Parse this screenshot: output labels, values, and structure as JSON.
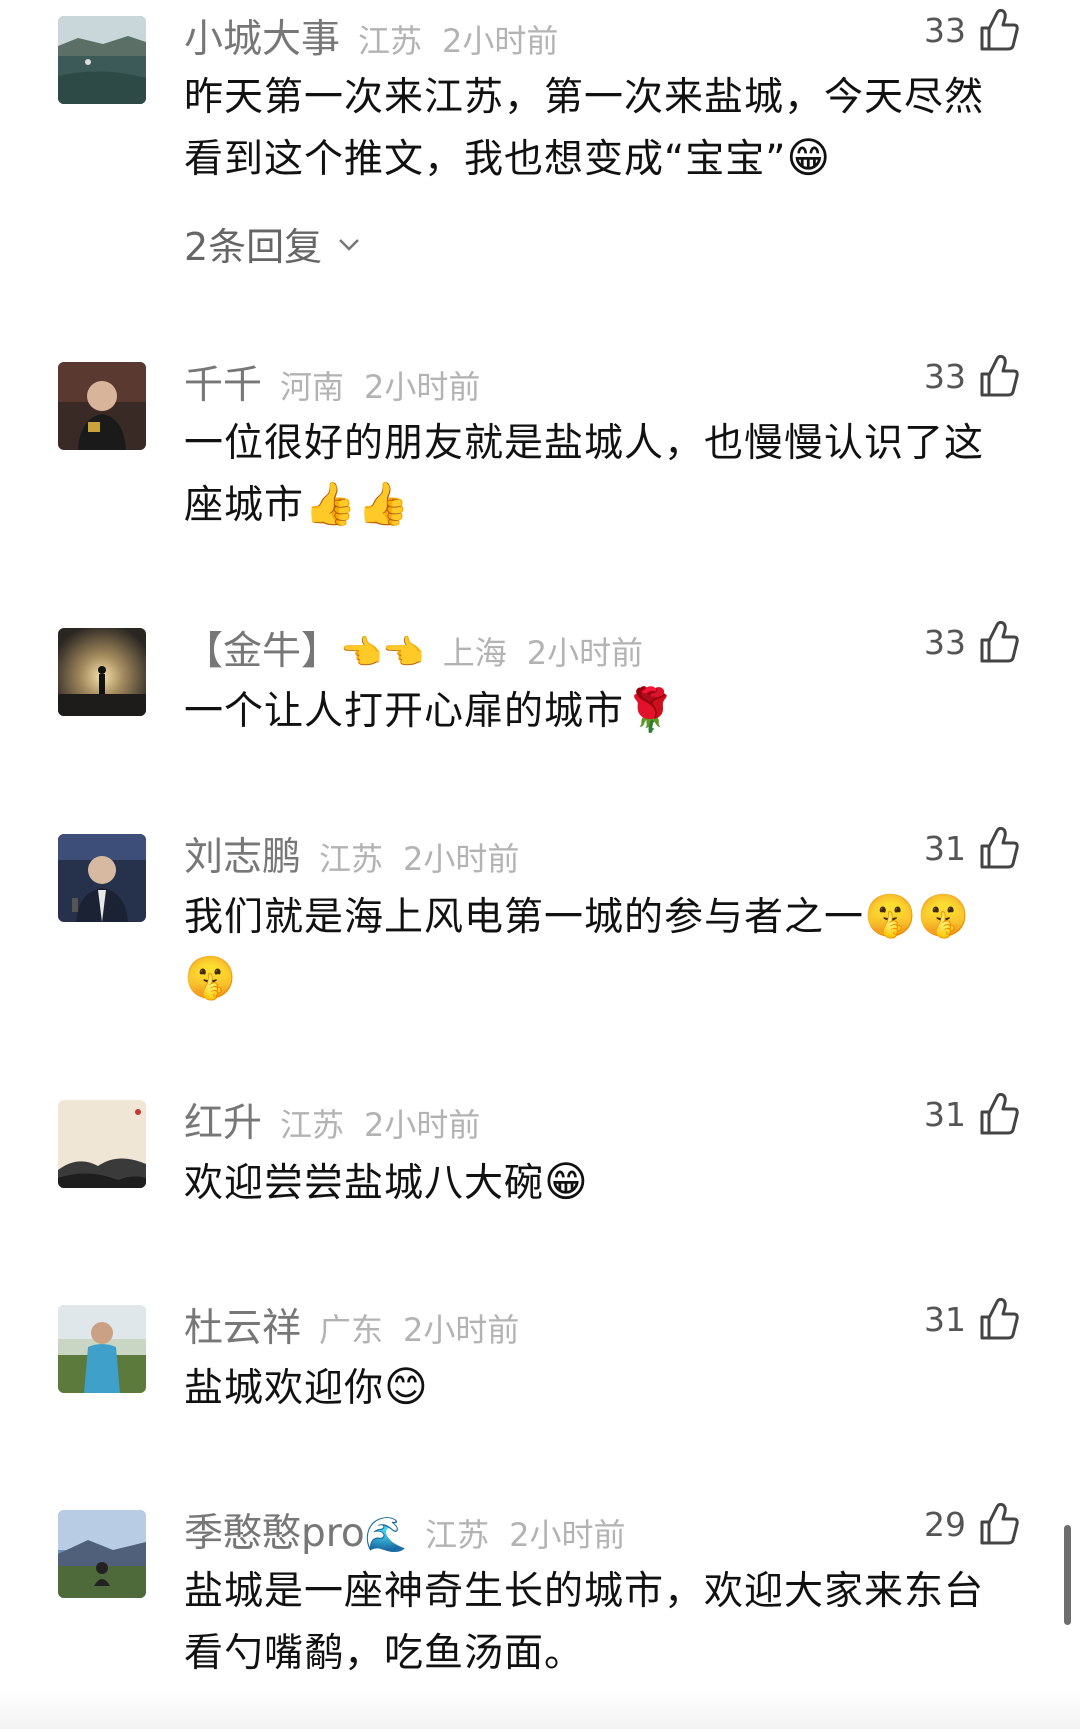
{
  "comments": [
    {
      "user": "小城大事",
      "user_emoji": "",
      "region": "江苏",
      "time": "2小时前",
      "likes": "33",
      "text": "昨天第一次来江苏，第一次来盐城，今天尽然看到这个推文，我也想变成“宝宝”",
      "text_emoji": "😁",
      "replies": "2条回复",
      "avatar": "lake-landscape"
    },
    {
      "user": "千千",
      "user_emoji": "",
      "region": "河南",
      "time": "2小时前",
      "likes": "33",
      "text": "一位很好的朋友就是盐城人，也慢慢认识了这座城市",
      "text_emoji": "👍👍",
      "replies": "",
      "avatar": "person-indoors"
    },
    {
      "user": "【金牛】",
      "user_emoji": "👈👈",
      "region": "上海",
      "time": "2小时前",
      "likes": "33",
      "text": "一个让人打开心扉的城市",
      "text_emoji": "🌹",
      "replies": "",
      "avatar": "sunset-silhouette"
    },
    {
      "user": "刘志鹏",
      "user_emoji": "",
      "region": "江苏",
      "time": "2小时前",
      "likes": "31",
      "text": "我们就是海上风电第一城的参与者之一",
      "text_emoji": "🤫🤫🤫",
      "replies": "",
      "avatar": "man-with-microphone"
    },
    {
      "user": "红升",
      "user_emoji": "",
      "region": "江苏",
      "time": "2小时前",
      "likes": "31",
      "text": "欢迎尝尝盐城八大碗",
      "text_emoji": "😁",
      "replies": "",
      "avatar": "ink-painting"
    },
    {
      "user": "杜云祥",
      "user_emoji": "",
      "region": "广东",
      "time": "2小时前",
      "likes": "31",
      "text": "盐城欢迎你",
      "text_emoji": "😊",
      "replies": "",
      "avatar": "boy-outdoors"
    },
    {
      "user": "季憨憨pro",
      "user_emoji": "🌊",
      "region": "江苏",
      "time": "2小时前",
      "likes": "29",
      "text": "盐城是一座神奇生长的城市，欢迎大家来东台看勺嘴鹬，吃鱼汤面。",
      "text_emoji": "",
      "replies": "",
      "avatar": "mountain-view"
    }
  ],
  "icons": {
    "like": "thumbs-up-icon",
    "expand": "chevron-down-icon"
  },
  "colors": {
    "username": "#777777",
    "meta": "#b3b3b3",
    "text": "#111111",
    "background": "#ffffff"
  }
}
